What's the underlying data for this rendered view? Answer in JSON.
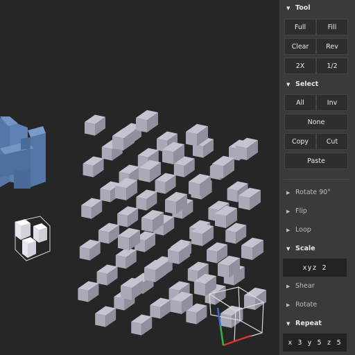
{
  "panel": {
    "tool": {
      "title": "Tool",
      "buttons": [
        "Full",
        "Fill",
        "Clear",
        "Rev",
        "2X",
        "1/2"
      ]
    },
    "select": {
      "title": "Select",
      "buttons": [
        "All",
        "Inv",
        "None",
        "Copy",
        "Cut",
        "Paste"
      ]
    },
    "rotate90": {
      "title": "Rotate 90°"
    },
    "flip": {
      "title": "Flip"
    },
    "loop": {
      "title": "Loop"
    },
    "scale": {
      "title": "Scale",
      "value": "xyz  2"
    },
    "shear": {
      "title": "Shear"
    },
    "rotate": {
      "title": "Rotate"
    },
    "repeat": {
      "title": "Repeat",
      "value": "x 3 y 5 z 5"
    }
  },
  "icons": {
    "expanded": "triangle-down-icon",
    "collapsed": "triangle-right-icon"
  },
  "colors": {
    "background": "#262626",
    "panel": "#3a3a3a",
    "button": "#2e2e2e",
    "voxel_gray": "#a8a8b8",
    "voxel_blue": "#5a7cae",
    "axis_x": "#e03030",
    "axis_y": "#3ab03a",
    "axis_z": "#3a6ce0"
  }
}
